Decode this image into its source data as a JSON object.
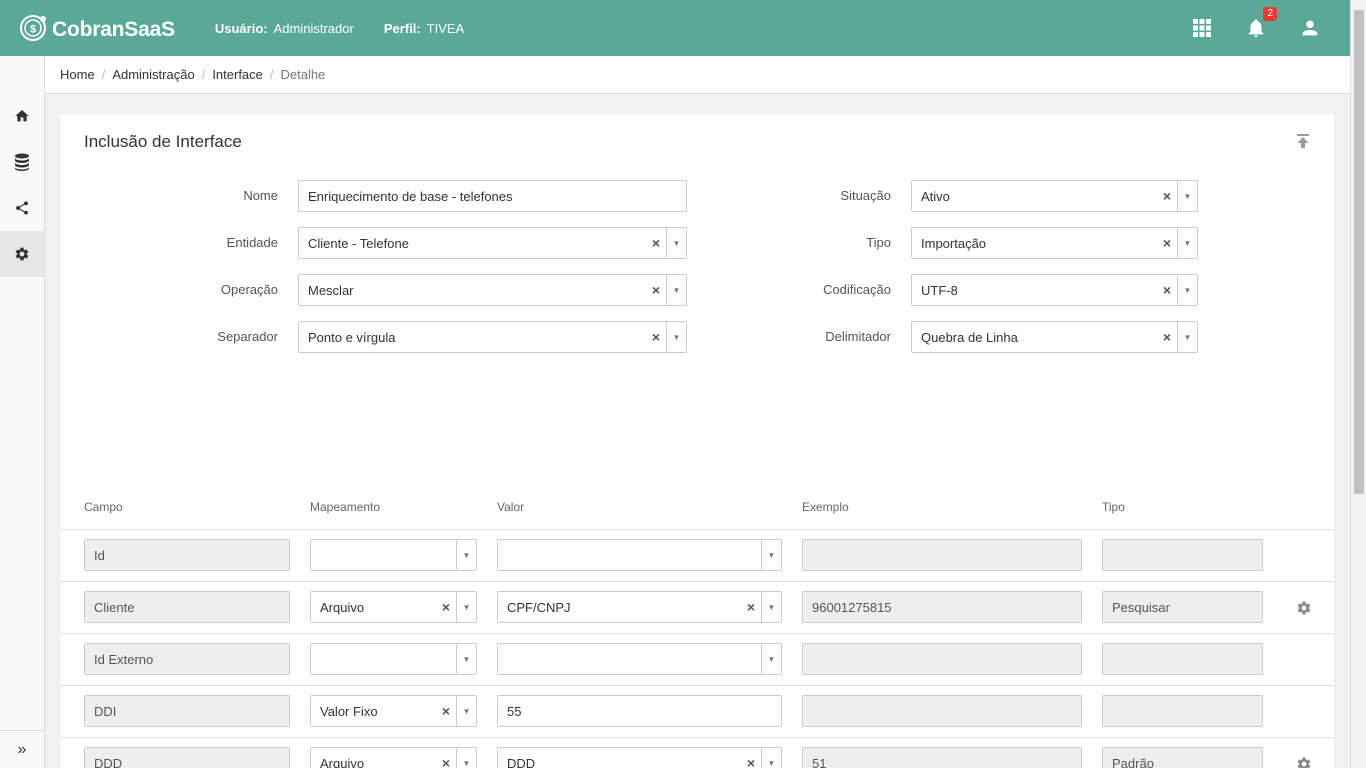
{
  "header": {
    "brand": "CobranSaaS",
    "user_label": "Usuário:",
    "user_value": "Administrador",
    "profile_label": "Perfil:",
    "profile_value": "TIVEA",
    "notifications_count": "2",
    "brand_color": "#5aa897"
  },
  "sidebar": {
    "items": [
      "home-icon",
      "database-icon",
      "share-icon",
      "gear-icon"
    ],
    "collapse": "»"
  },
  "breadcrumb": {
    "items": [
      "Home",
      "Administração",
      "Interface"
    ],
    "current": "Detalhe"
  },
  "form": {
    "title": "Inclusão de Interface",
    "nome_label": "Nome",
    "nome_value": "Enriquecimento de base - telefones",
    "entidade_label": "Entidade",
    "entidade_value": "Cliente - Telefone",
    "operacao_label": "Operação",
    "operacao_value": "Mesclar",
    "separador_label": "Separador",
    "separador_value": "Ponto e vírgula",
    "situacao_label": "Situação",
    "situacao_value": "Ativo",
    "tipo_label": "Tipo",
    "tipo_value": "Importação",
    "codificacao_label": "Codificação",
    "codificacao_value": "UTF-8",
    "delimitador_label": "Delimitador",
    "delimitador_value": "Quebra de Linha"
  },
  "table": {
    "columns": [
      "Campo",
      "Mapeamento",
      "Valor",
      "Exemplo",
      "Tipo"
    ],
    "rows": [
      {
        "campo": "Id",
        "mapeamento": "",
        "valor": "",
        "exemplo": "",
        "tipo": ""
      },
      {
        "campo": "Cliente",
        "mapeamento": "Arquivo",
        "valor": "CPF/CNPJ",
        "exemplo": "96001275815",
        "tipo": "Pesquisar"
      },
      {
        "campo": "Id Externo",
        "mapeamento": "",
        "valor": "",
        "exemplo": "",
        "tipo": ""
      },
      {
        "campo": "DDI",
        "mapeamento": "Valor Fixo",
        "valor": "55",
        "exemplo": "",
        "tipo": ""
      },
      {
        "campo": "DDD",
        "mapeamento": "Arquivo",
        "valor": "DDD",
        "exemplo": "51",
        "tipo": "Padrão"
      }
    ]
  }
}
